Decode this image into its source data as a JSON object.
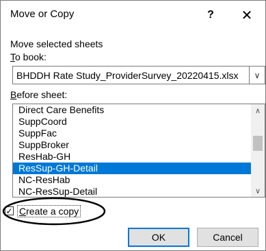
{
  "dialog": {
    "title": "Move or Copy",
    "help": "?",
    "close": "✕"
  },
  "labels": {
    "move_selected": "Move selected sheets",
    "to_book_hotkey": "T",
    "to_book_rest": "o book:",
    "before_sheet_hotkey": "B",
    "before_sheet_rest": "efore sheet:"
  },
  "to_book": {
    "value": "BHDDH Rate Study_ProviderSurvey_20220415.xlsx",
    "arrow": "∨"
  },
  "before_sheet": {
    "items": [
      "Direct Care Benefits",
      "SuppCoord",
      "SuppFac",
      "SuppBroker",
      "ResHab-GH",
      "ResSup-GH-Detail",
      "NC-ResHab",
      "NC-ResSup-Detail"
    ],
    "selected_index": 5,
    "scroll_up": "∧",
    "scroll_down": "∨"
  },
  "create_copy": {
    "checked": true,
    "check_mark": "✓",
    "hotkey": "C",
    "rest": "reate a copy"
  },
  "buttons": {
    "ok": "OK",
    "cancel": "Cancel"
  }
}
